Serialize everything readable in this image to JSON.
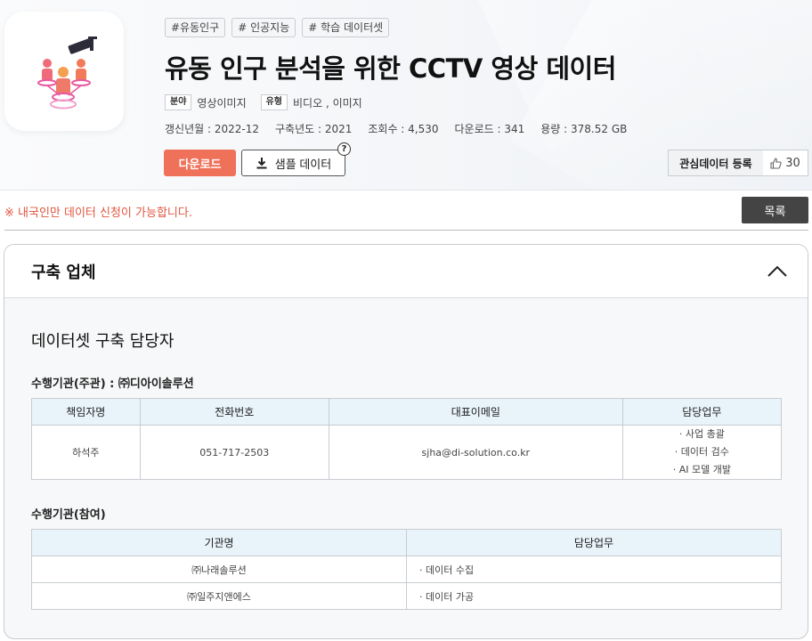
{
  "header": {
    "tags": [
      "#유동인구",
      "# 인공지능",
      "# 학습 데이터셋"
    ],
    "title": "유동 인구 분석을 위한 CCTV 영상 데이터",
    "field_badge": "분야",
    "field_value": "영상이미지",
    "type_badge": "유형",
    "type_value": "비디오 , 이미지",
    "updated": "갱신년월 : 2022-12",
    "built_year": "구축년도 : 2021",
    "views": "조회수 : 4,530",
    "downloads": "다운로드 : 341",
    "size": "용량 : 378.52 GB",
    "download_label": "다운로드",
    "sample_label": "샘플 데이터",
    "help_mark": "?",
    "interest_label": "관심데이터 등록",
    "like_count": "30"
  },
  "notice": {
    "text": "※ 내국인만 데이터 신청이 가능합니다.",
    "list_button": "목록"
  },
  "panel": {
    "title": "구축 업체",
    "section_title": "데이터셋 구축 담당자",
    "lead_org": "수행기관(주관) : ㈜디아이솔루션",
    "lead_table": {
      "headers": [
        "책임자명",
        "전화번호",
        "대표이메일",
        "담당업무"
      ],
      "row": {
        "name": "하석주",
        "phone": "051-717-2503",
        "email": "sjha@di-solution.co.kr",
        "duties": [
          "· 사업 총괄",
          "· 데이터 검수",
          "· AI 모델 개발"
        ]
      }
    },
    "participant_title": "수행기관(참여)",
    "participant_table": {
      "headers": [
        "기관명",
        "담당업무"
      ],
      "rows": [
        {
          "org": "㈜나래솔루션",
          "duty": "· 데이터 수집"
        },
        {
          "org": "㈜일주지앤에스",
          "duty": "· 데이터 가공"
        }
      ]
    }
  },
  "colors": {
    "accent": "#f0715a",
    "notice": "#e2553e",
    "table_header": "#e8f3fa",
    "dark_button": "#444444"
  },
  "icons": [
    "cctv-people-icon",
    "download-icon",
    "help-icon",
    "thumbs-up-icon",
    "chevron-up-icon"
  ]
}
